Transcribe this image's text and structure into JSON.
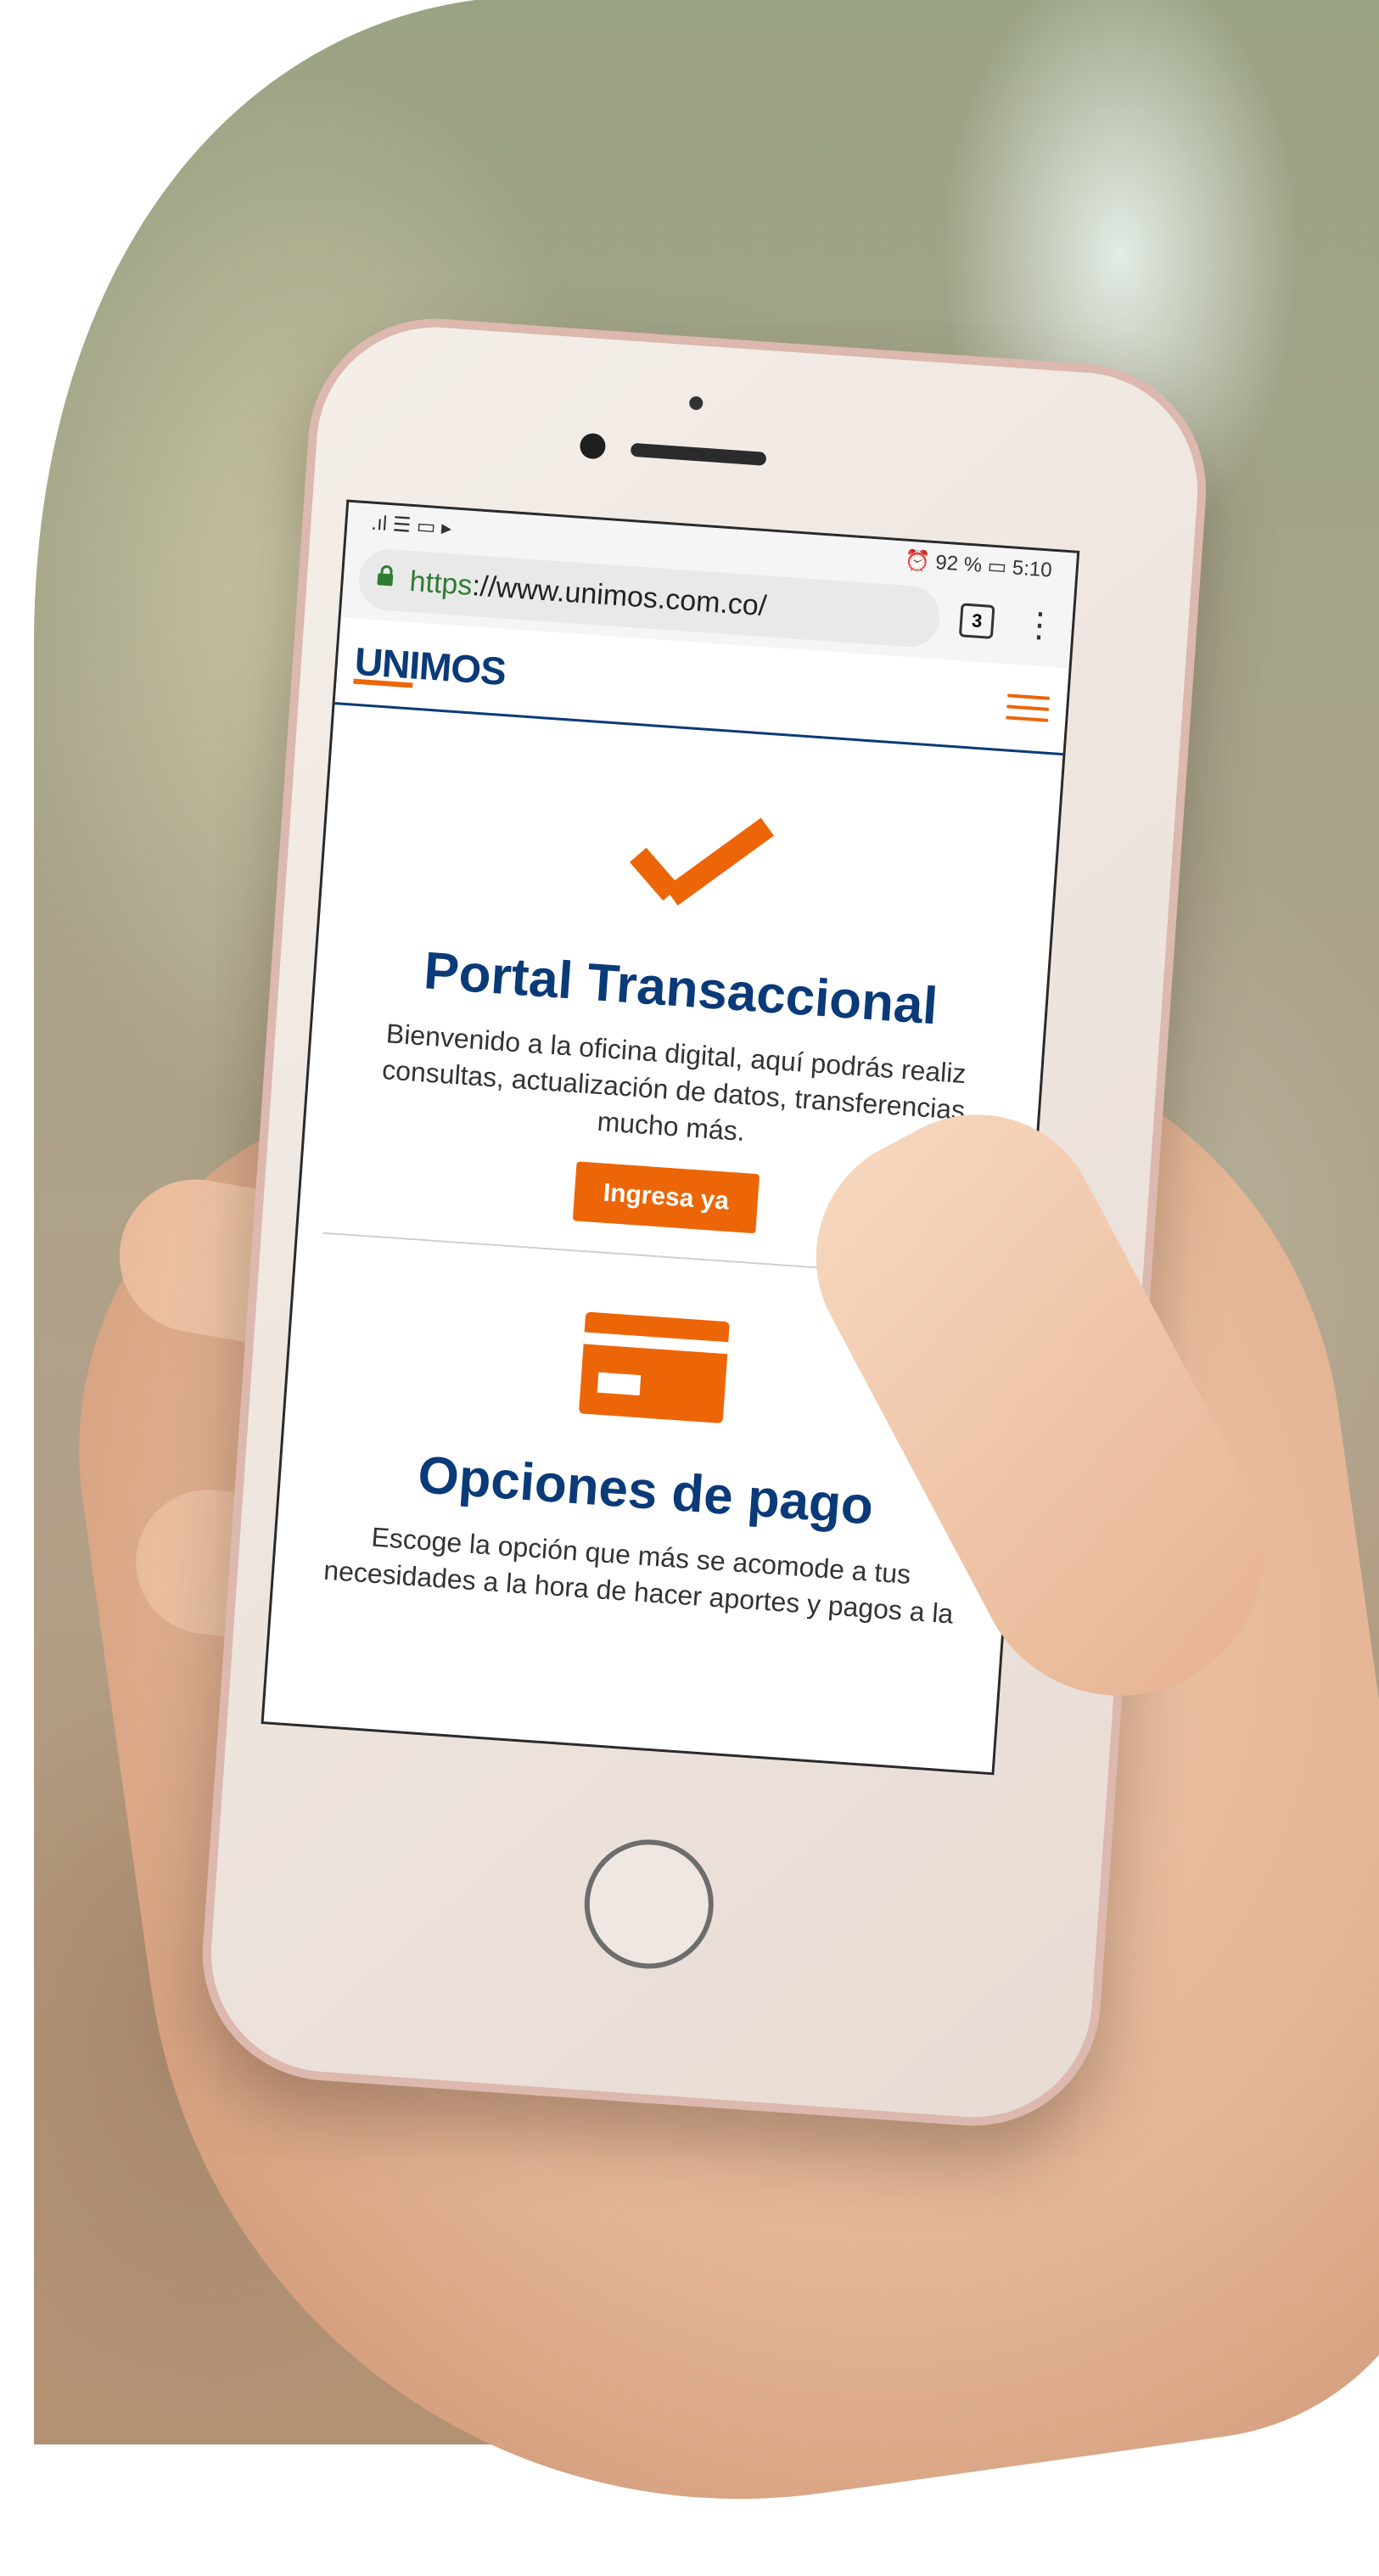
{
  "status_bar": {
    "battery": "92 %",
    "time": "5:10"
  },
  "browser": {
    "url_scheme": "https",
    "url_rest": "://www.unimos.com.co/",
    "tab_count": "3"
  },
  "site": {
    "logo_text": "UNIMOS"
  },
  "sections": [
    {
      "title": "Portal Transaccional",
      "text": "Bienvenido a la oficina digital, aquí podrás realiz consultas, actualización de datos, transferencias mucho más.",
      "button": "Ingresa ya"
    },
    {
      "title": "Opciones de pago",
      "text": "Escoge la opción que más se acomode a tus necesidades a la hora de hacer aportes y pagos a la"
    }
  ],
  "colors": {
    "brand_blue": "#0a3a78",
    "brand_orange": "#ec6608",
    "secure_green": "#2e7d32"
  }
}
